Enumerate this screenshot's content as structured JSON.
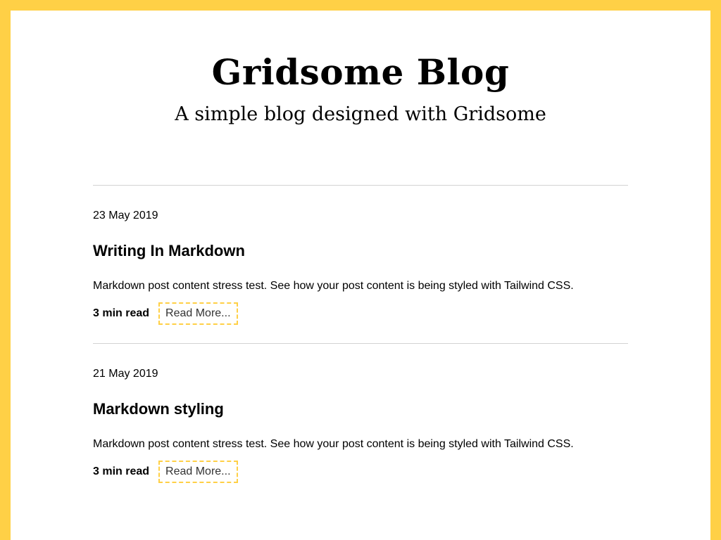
{
  "header": {
    "title": "Gridsome Blog",
    "subtitle": "A simple blog designed with Gridsome"
  },
  "posts": [
    {
      "date": "23 May 2019",
      "title": "Writing In Markdown",
      "excerpt": "Markdown post content stress test. See how your post content is being styled with Tailwind CSS.",
      "read_time": "3 min read",
      "read_more_label": "Read More..."
    },
    {
      "date": "21 May 2019",
      "title": "Markdown styling",
      "excerpt": "Markdown post content stress test. See how your post content is being styled with Tailwind CSS.",
      "read_time": "3 min read",
      "read_more_label": "Read More..."
    }
  ],
  "colors": {
    "accent": "#ffd046",
    "divider": "#d3d3d3",
    "text": "#000000"
  }
}
